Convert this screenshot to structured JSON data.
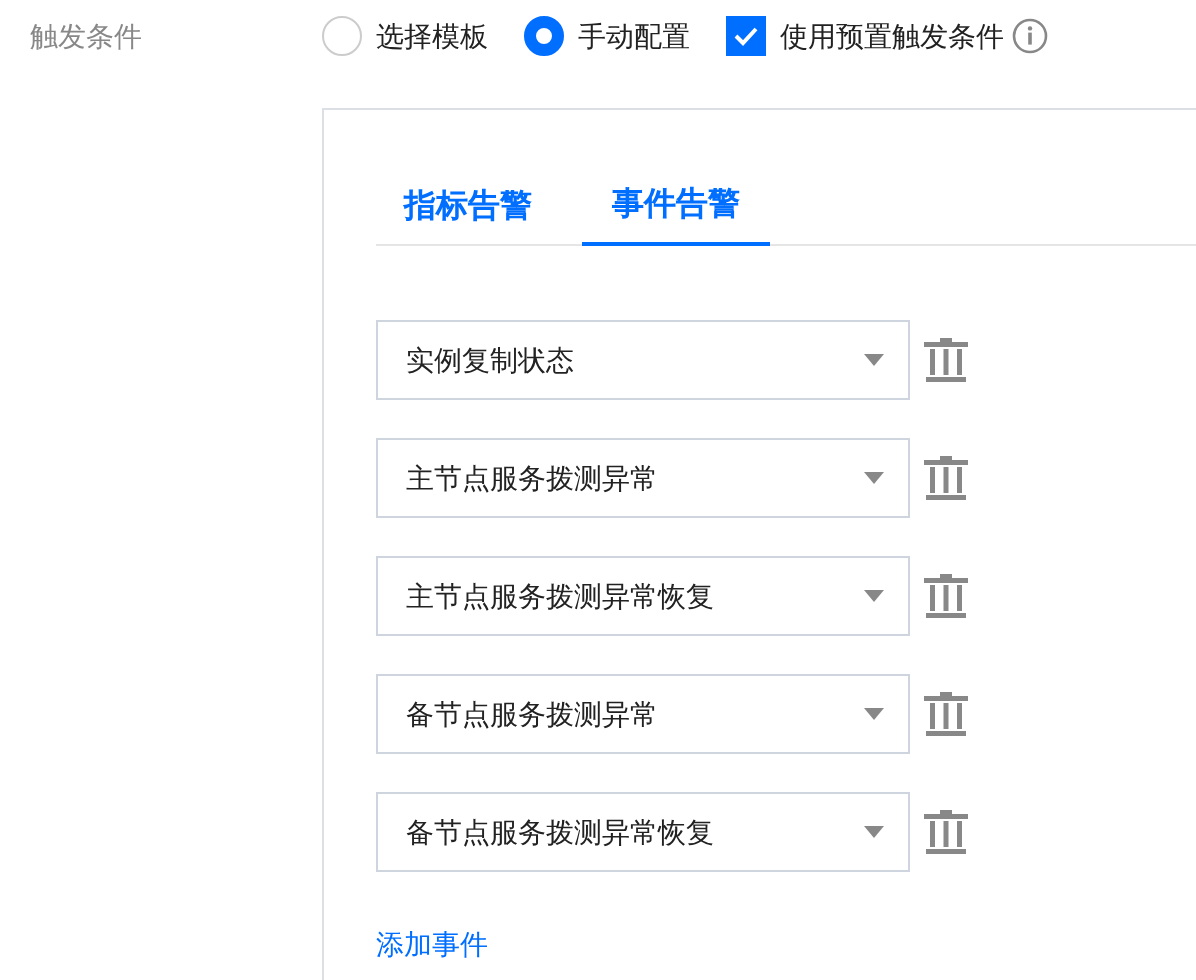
{
  "field_label": "触发条件",
  "options": [
    {
      "kind": "radio",
      "label": "选择模板",
      "selected": false
    },
    {
      "kind": "radio",
      "label": "手动配置",
      "selected": true
    },
    {
      "kind": "checkbox",
      "label": "使用预置触发条件",
      "checked": true
    }
  ],
  "tabs": [
    {
      "label": "指标告警",
      "selected": false
    },
    {
      "label": "事件告警",
      "selected": true
    }
  ],
  "events": [
    {
      "value": "实例复制状态"
    },
    {
      "value": "主节点服务拨测异常"
    },
    {
      "value": "主节点服务拨测异常恢复"
    },
    {
      "value": "备节点服务拨测异常"
    },
    {
      "value": "备节点服务拨测异常恢复"
    }
  ],
  "add_link": "添加事件"
}
